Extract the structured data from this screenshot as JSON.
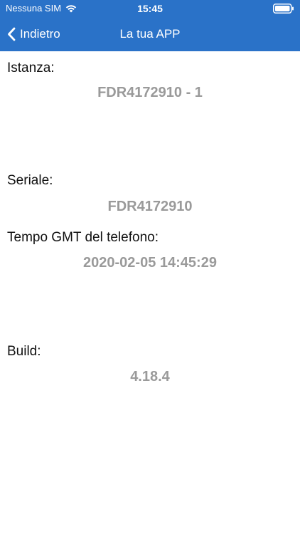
{
  "status_bar": {
    "carrier": "Nessuna SIM",
    "time": "15:45",
    "icons": [
      "wifi-icon",
      "battery-icon"
    ]
  },
  "nav": {
    "back_label": "Indietro",
    "title": "La tua APP"
  },
  "fields": [
    {
      "label": "Istanza:",
      "value": "FDR4172910 - 1"
    },
    {
      "label": "Seriale:",
      "value": "FDR4172910"
    },
    {
      "label": "Tempo GMT del telefono:",
      "value": "2020-02-05 14:45:29"
    },
    {
      "label": "Build:",
      "value": "4.18.4"
    }
  ],
  "colors": {
    "header": "#2a72c8",
    "label_text": "#111111",
    "value_text": "#9a9a9a",
    "background": "#ffffff"
  }
}
